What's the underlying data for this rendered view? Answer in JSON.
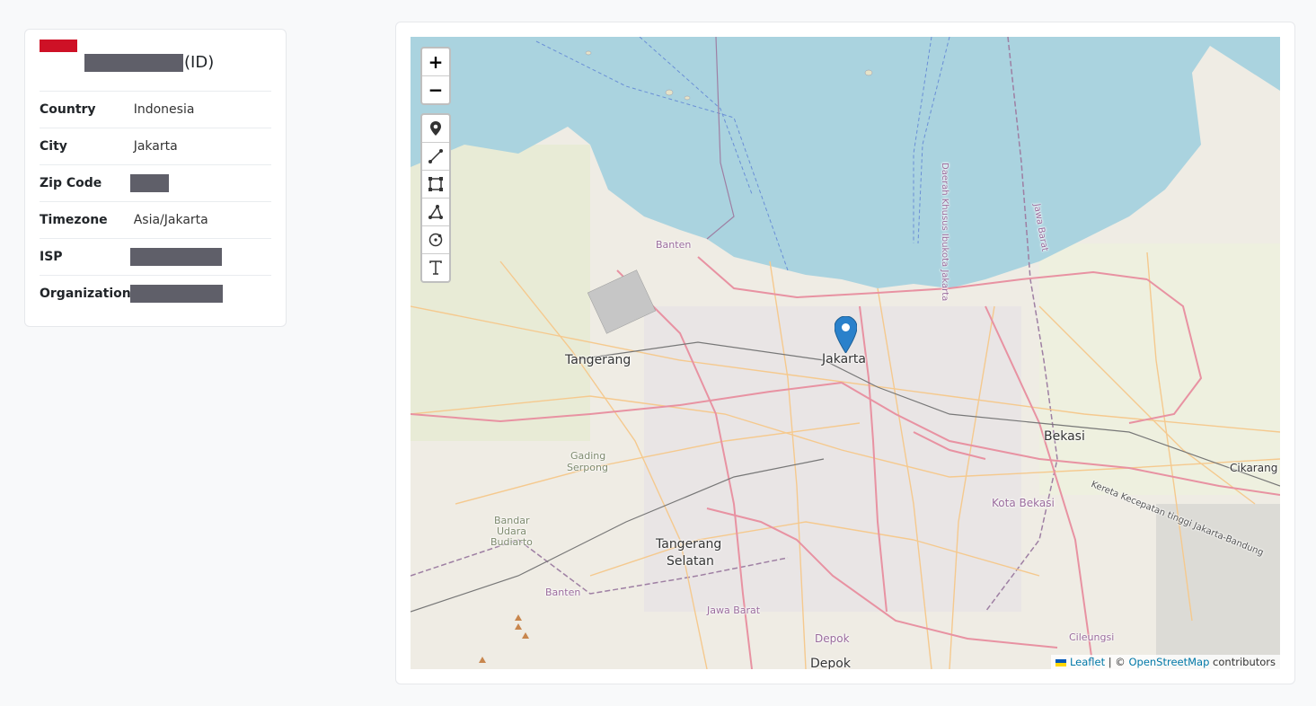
{
  "header": {
    "flag": "indonesia-flag",
    "name": "",
    "country_code": "(ID)"
  },
  "details": [
    {
      "key": "Country",
      "value": "Indonesia"
    },
    {
      "key": "City",
      "value": "Jakarta"
    },
    {
      "key": "Zip Code",
      "value": ""
    },
    {
      "key": "Timezone",
      "value": "Asia/Jakarta"
    },
    {
      "key": "ISP",
      "value": ""
    },
    {
      "key": "Organization",
      "value": ""
    }
  ],
  "map": {
    "zoom_in": "+",
    "zoom_out": "−",
    "draw_tools": [
      "marker-icon",
      "polyline-icon",
      "rectangle-icon",
      "polygon-icon",
      "circle-icon",
      "text-icon"
    ],
    "labels": {
      "jakarta": "Jakarta",
      "tangerang": "Tangerang",
      "bekasi": "Bekasi",
      "tangerang_selatan_1": "Tangerang",
      "tangerang_selatan_2": "Selatan",
      "depok": "Depok",
      "depok_small": "Depok",
      "cikarang": "Cikarang",
      "kota_bekasi": "Kota Bekasi",
      "gading_1": "Gading",
      "gading_2": "Serpong",
      "bandar_1": "Bandar",
      "bandar_2": "Udara",
      "bandar_3": "Budiarto",
      "banten_1": "Banten",
      "banten_2": "Banten",
      "jawa_barat": "Jawa Barat",
      "cileungsi": "Cileungsi",
      "daerah": "Daerah Khusus Ibukota Jakarta",
      "jawa_barat_v": "Jawa Barat",
      "kereta": "Kereta Kecepatan tinggi Jakarta-Bandung"
    },
    "attribution": {
      "leaflet": "Leaflet",
      "sep": " | © ",
      "osm": "OpenStreetMap",
      "tail": " contributors"
    },
    "colors": {
      "sea": "#aad3df",
      "land": "#f2efe9",
      "motorway": "#e892a2",
      "primary": "#fcd6a4",
      "boundary": "#9e7fa3"
    }
  }
}
